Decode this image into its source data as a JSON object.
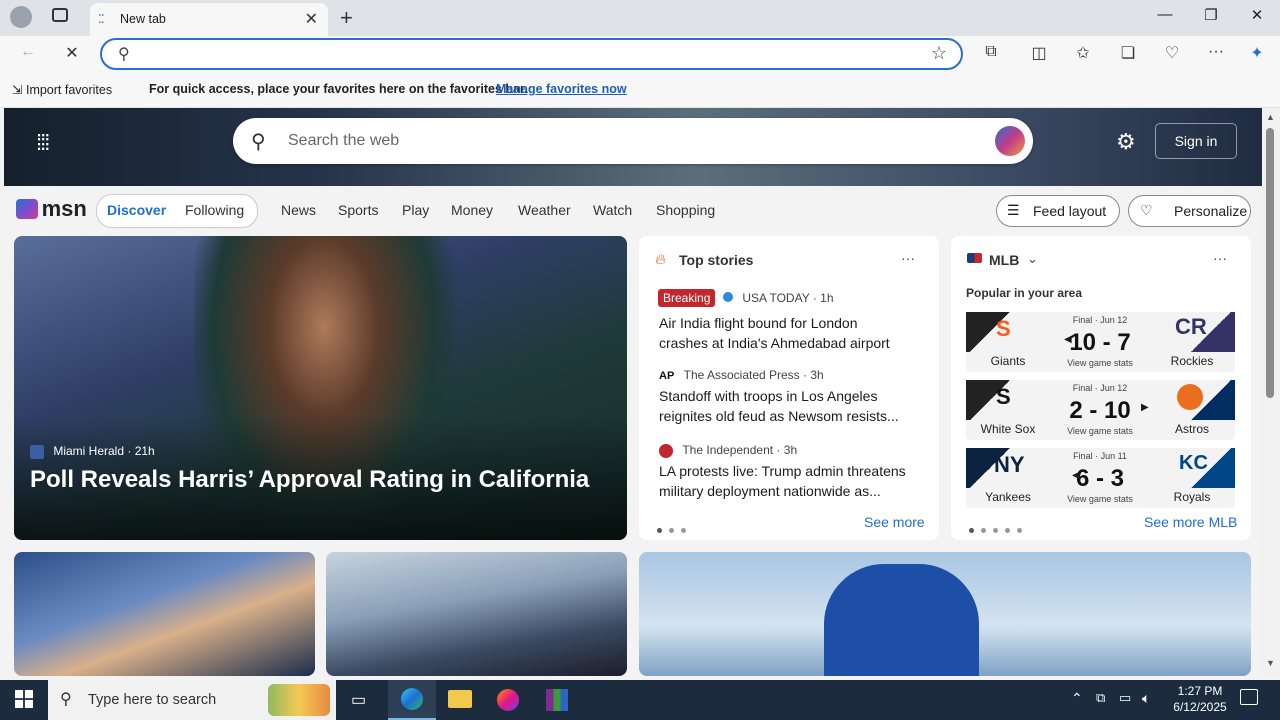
{
  "browser": {
    "tab_title": "New tab",
    "favbar_import": "Import favorites",
    "favbar_text": "For quick access, place your favorites here on the favorites bar.",
    "favbar_link": "Manage favorites now"
  },
  "msn": {
    "search_placeholder": "Search the web",
    "signin": "Sign in",
    "logo": "msn",
    "tabs": [
      "Discover",
      "Following"
    ],
    "nav": [
      "News",
      "Sports",
      "Play",
      "Money",
      "Weather",
      "Watch",
      "Shopping"
    ],
    "feed_layout": "Feed layout",
    "personalize": "Personalize"
  },
  "hero_story": {
    "source": "Miami Herald",
    "age": "21h",
    "headline": "Poll Reveals Harris’ Approval Rating in California"
  },
  "top_stories": {
    "title": "Top stories",
    "see_more": "See more",
    "items": [
      {
        "badge": "Breaking",
        "source": "USA TODAY",
        "age": "1h",
        "title": "Air India flight bound for London crashes at India's Ahmedabad airport"
      },
      {
        "source": "The Associated Press",
        "age": "3h",
        "title": "Standoff with troops in Los Angeles reignites old feud as Newsom resists..."
      },
      {
        "source": "The Independent",
        "age": "3h",
        "title": "LA protests live: Trump admin threatens military deployment nationwide as..."
      }
    ]
  },
  "mlb": {
    "title": "MLB",
    "subtitle": "Popular in your area",
    "see_more": "See more MLB",
    "games": [
      {
        "status": "Final · Jun 12",
        "home": "Giants",
        "away": "Rockies",
        "score": "10 - 7",
        "link": "View game stats"
      },
      {
        "status": "Final · Jun 12",
        "home": "White Sox",
        "away": "Astros",
        "score": "2 - 10",
        "link": "View game stats"
      },
      {
        "status": "Final · Jun 11",
        "home": "Yankees",
        "away": "Royals",
        "score": "6 - 3",
        "link": "View game stats"
      }
    ]
  },
  "taskbar": {
    "search_placeholder": "Type here to search",
    "time": "1:27 PM",
    "date": "6/12/2025"
  },
  "colors": {
    "accent": "#2a6fcd",
    "breaking": "#c4262e",
    "discover": "#1f6fcf"
  }
}
